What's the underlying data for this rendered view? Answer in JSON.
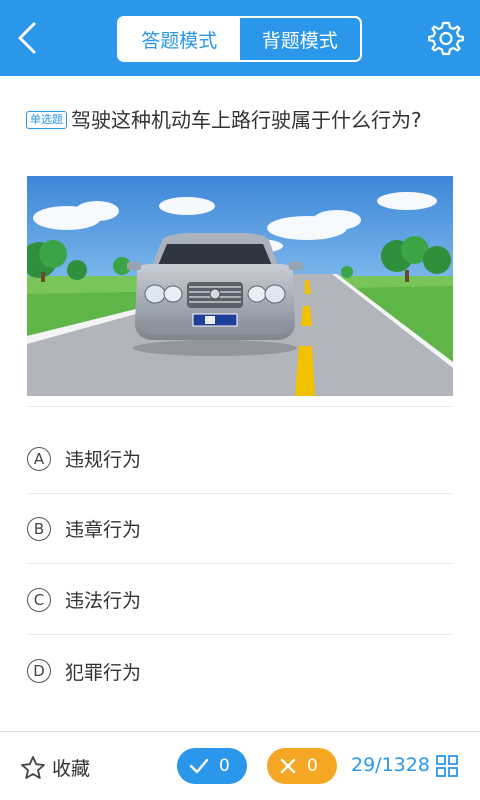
{
  "header": {
    "modes": [
      {
        "label": "答题模式",
        "active": true
      },
      {
        "label": "背题模式",
        "active": false
      }
    ],
    "accent_color": "#2b97ea"
  },
  "question": {
    "type_tag": "单选题",
    "text": "驾驶这种机动车上路行驶属于什么行为?"
  },
  "options": [
    {
      "letter": "A",
      "text": "违规行为"
    },
    {
      "letter": "B",
      "text": "违章行为"
    },
    {
      "letter": "C",
      "text": "违法行为"
    },
    {
      "letter": "D",
      "text": "犯罪行为"
    }
  ],
  "bottom_bar": {
    "favorite_label": "收藏",
    "correct_count": "0",
    "wrong_count": "0",
    "progress": "29/1328",
    "correct_color": "#2b97ea",
    "wrong_color": "#f5a623"
  }
}
